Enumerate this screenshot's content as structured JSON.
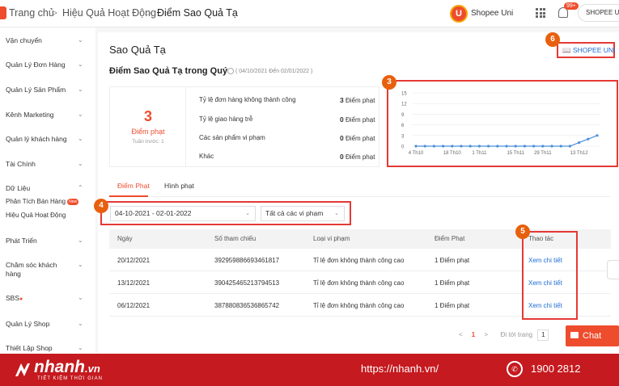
{
  "breadcrumb": {
    "home": "Trang chủ",
    "sep": ">",
    "section": "Hiệu Quả Hoạt Động",
    "current": "Điểm Sao Quả Tạ"
  },
  "topbar": {
    "uni_label": "Shopee Uni",
    "notif_badge": "99+",
    "shop_label": "SHOPEE UNI"
  },
  "sidebar": {
    "items": [
      {
        "label": "Vận chuyển"
      },
      {
        "label": "Quản Lý Đơn Hàng"
      },
      {
        "label": "Quản Lý Sản Phẩm"
      },
      {
        "label": "Kênh Marketing"
      },
      {
        "label": "Quản lý khách hàng"
      },
      {
        "label": "Tài Chính"
      },
      {
        "label": "Dữ Liệu"
      },
      {
        "label": "Phát Triển"
      },
      {
        "label": "Chăm sóc khách hàng"
      },
      {
        "label": "SBS"
      },
      {
        "label": "Quản Lý Shop"
      },
      {
        "label": "Thiết Lập Shop"
      }
    ],
    "subitems": [
      {
        "label": "Phân Tích Bán Hàng",
        "badge": "New"
      },
      {
        "label": "Hiệu Quả Hoạt Động"
      }
    ]
  },
  "page": {
    "title": "Sao Quả Tạ",
    "subtitle": "Điểm Sao Quả Tạ trong Quý",
    "period": "( 04/10/2021 Đến 02/01/2022 )",
    "uni_link": "SHOPEE UNI"
  },
  "score": {
    "value": "3",
    "label": "Điểm phạt",
    "previous": "Tuần trước: 1"
  },
  "stats": [
    {
      "label": "Tỷ lệ đơn hàng không thành công",
      "value": "3",
      "unit": "Điểm phạt"
    },
    {
      "label": "Tỷ lệ giao hàng trễ",
      "value": "0",
      "unit": "Điểm phạt"
    },
    {
      "label": "Các sản phẩm vi phạm",
      "value": "0",
      "unit": "Điểm phạt"
    },
    {
      "label": "Khác",
      "value": "0",
      "unit": "Điểm phạt"
    }
  ],
  "chart_data": {
    "type": "line",
    "categories": [
      "4 Th10",
      "18 Th10",
      "1 Th11",
      "15 Th11",
      "29 Th11",
      "13 Th12"
    ],
    "values": [
      0,
      0,
      0,
      0,
      0,
      0,
      0,
      0,
      0,
      0,
      0,
      0,
      0,
      0,
      0,
      0,
      0,
      0,
      1,
      2,
      3
    ],
    "yticks": [
      0,
      3,
      6,
      9,
      12,
      15
    ],
    "ylim": [
      0,
      15
    ],
    "title": "",
    "xlabel": "",
    "ylabel": "",
    "grid": true,
    "color": "#4a90d9"
  },
  "tabs": [
    {
      "label": "Điểm Phạt"
    },
    {
      "label": "Hình phạt"
    }
  ],
  "filters": {
    "date_range": "04-10-2021 - 02-01-2022",
    "violation_type": "Tất cả các vi phạm"
  },
  "table": {
    "headers": [
      "Ngày",
      "Số tham chiếu",
      "Loại vi phạm",
      "Điểm Phạt",
      "Thao tác"
    ],
    "rows": [
      {
        "date": "20/12/2021",
        "ref": "392959886693461817",
        "type": "Tỉ lệ đơn không thành công cao",
        "points": "1 Điểm phạt",
        "action": "Xem chi tiết"
      },
      {
        "date": "13/12/2021",
        "ref": "390425465213794513",
        "type": "Tỉ lệ đơn không thành công cao",
        "points": "1 Điểm phạt",
        "action": "Xem chi tiết"
      },
      {
        "date": "06/12/2021",
        "ref": "387880836536865742",
        "type": "Tỉ lệ đơn không thành công cao",
        "points": "1 Điểm phạt",
        "action": "Xem chi tiết"
      }
    ]
  },
  "pager": {
    "prev": "<",
    "current": "1",
    "next": ">",
    "goto_label": "Đi tới trang",
    "goto_value": "1"
  },
  "markers": [
    "3",
    "4",
    "5",
    "6"
  ],
  "chat": {
    "label": "Chat"
  },
  "footer": {
    "brand": "nhanh",
    "brand_suffix": ".vn",
    "tagline": "TIẾT KIỆM THỜI GIAN",
    "url": "https://nhanh.vn/",
    "phone": "1900 2812"
  }
}
